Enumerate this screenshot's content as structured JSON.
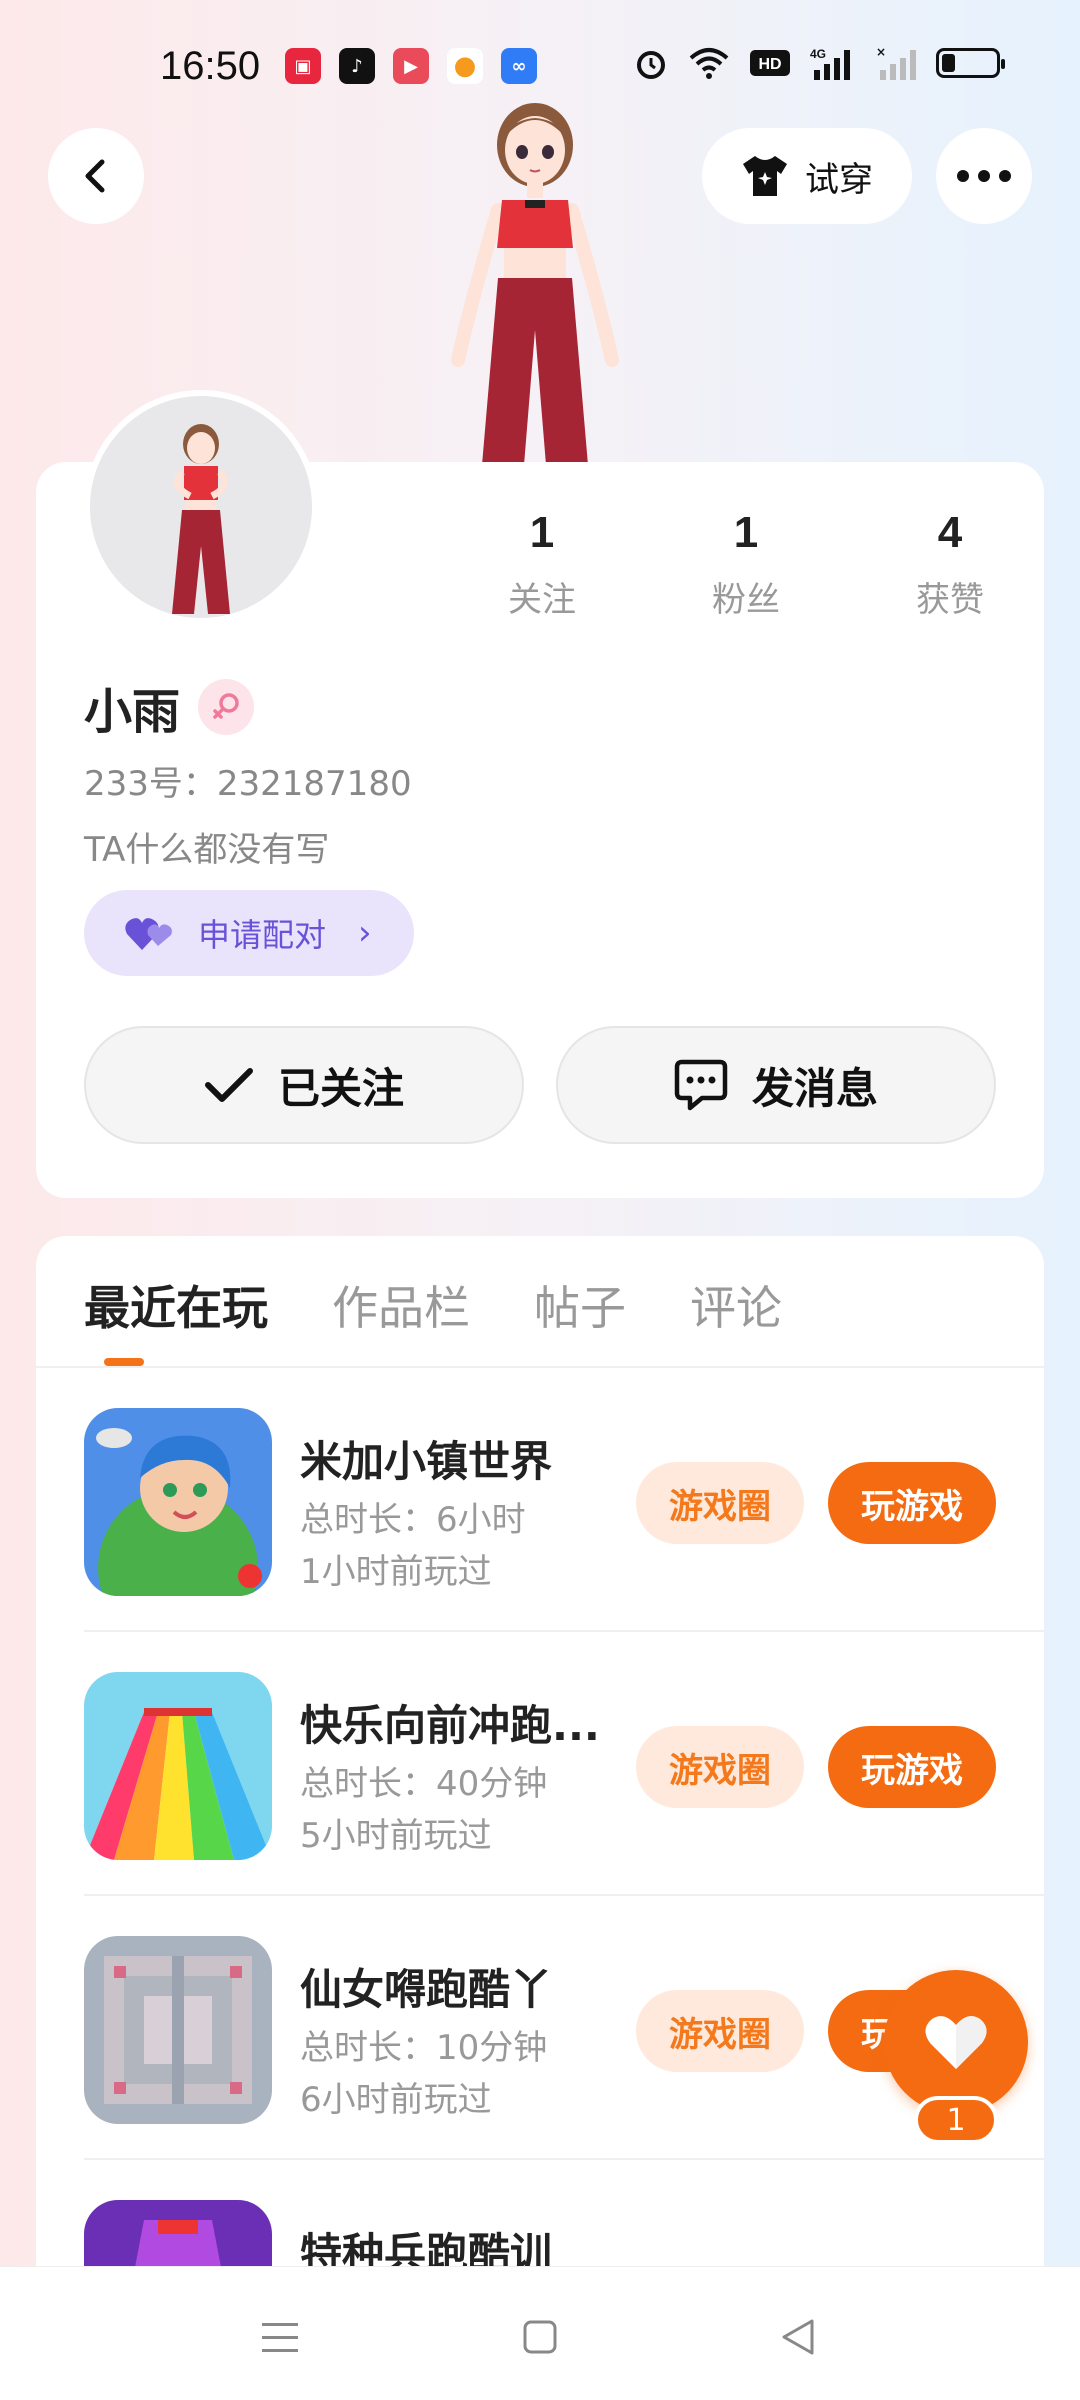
{
  "status_bar": {
    "time": "16:50",
    "app_icons": [
      {
        "name": "app-icon-1",
        "color": "#e8273e"
      },
      {
        "name": "tiktok-icon",
        "color": "#111111"
      },
      {
        "name": "video-app-icon",
        "color": "#e94b5a"
      },
      {
        "name": "shop-app-icon",
        "color": "#f59a1c"
      },
      {
        "name": "cloud-app-icon",
        "color": "#2f7cf6"
      }
    ],
    "battery_level": 0.25
  },
  "header": {
    "tryon_label": "试穿"
  },
  "profile": {
    "stats": [
      {
        "num": "1",
        "label": "关注"
      },
      {
        "num": "1",
        "label": "粉丝"
      },
      {
        "num": "4",
        "label": "获赞"
      }
    ],
    "username": "小雨",
    "uid": "233号：232187180",
    "bio": "TA什么都没有写",
    "pair_label": "申请配对",
    "follow_label": "已关注",
    "message_label": "发消息"
  },
  "tabs": [
    "最近在玩",
    "作品栏",
    "帖子",
    "评论"
  ],
  "games": [
    {
      "title": "米加小镇世界",
      "duration": "总时长：6小时",
      "last_played": "1小时前玩过",
      "circle_label": "游戏圈",
      "play_label": "玩游戏"
    },
    {
      "title": "快乐向前冲跑...",
      "duration": "总时长：40分钟",
      "last_played": "5小时前玩过",
      "circle_label": "游戏圈",
      "play_label": "玩游戏"
    },
    {
      "title": "仙女嘚跑酷丫",
      "duration": "总时长：10分钟",
      "last_played": "6小时前玩过",
      "circle_label": "游戏圈",
      "play_label": "玩游戏"
    },
    {
      "title": "特种兵跑酷训",
      "duration": "",
      "last_played": "",
      "circle_label": "",
      "play_label": ""
    }
  ],
  "fab": {
    "count": "1"
  },
  "colors": {
    "accent": "#f46b12",
    "accent_light": "#ffe9dc",
    "pair_purple": "#6a52d8"
  }
}
